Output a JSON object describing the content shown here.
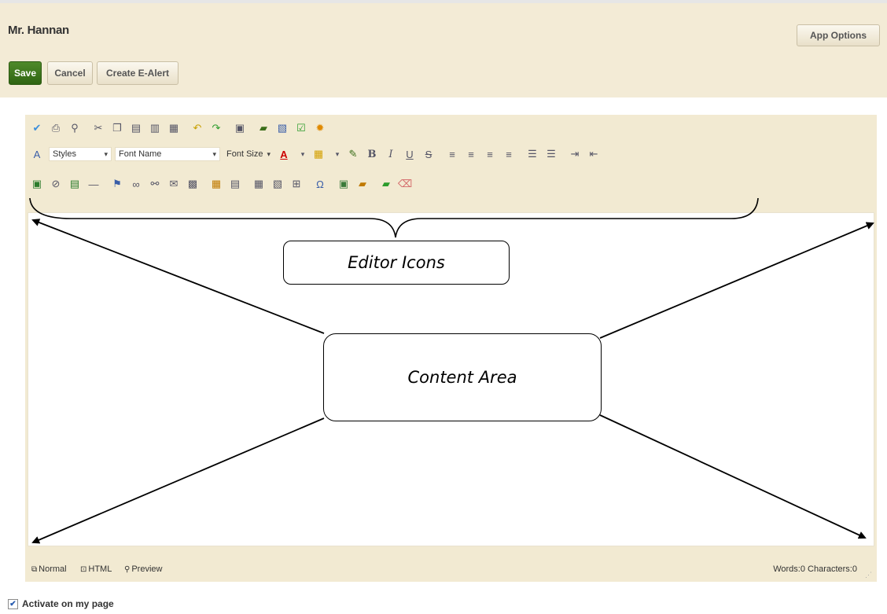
{
  "page": {
    "title": "Mr. Hannan",
    "buttons": {
      "save": "Save",
      "cancel": "Cancel",
      "create_ealert": "Create E-Alert",
      "app_options": "App Options"
    }
  },
  "editor": {
    "toolbar": {
      "styles": "Styles",
      "font_name": "Font Name",
      "font_size": "Font Size",
      "bold": "B",
      "italic": "I",
      "underline": "U",
      "strike": "S",
      "omega": "Ω"
    },
    "modes": {
      "normal": "Normal",
      "html": "HTML",
      "preview": "Preview"
    },
    "counts": "Words:0 Characters:0"
  },
  "annotations": {
    "editor_icons": "Editor Icons",
    "content_area": "Content Area"
  },
  "activate": {
    "label": "Activate on my page",
    "checked": true
  },
  "colors": {
    "header_bg": "#f3ebd6",
    "save_green": "#3a7418",
    "editor_bg": "#f2ead2"
  }
}
